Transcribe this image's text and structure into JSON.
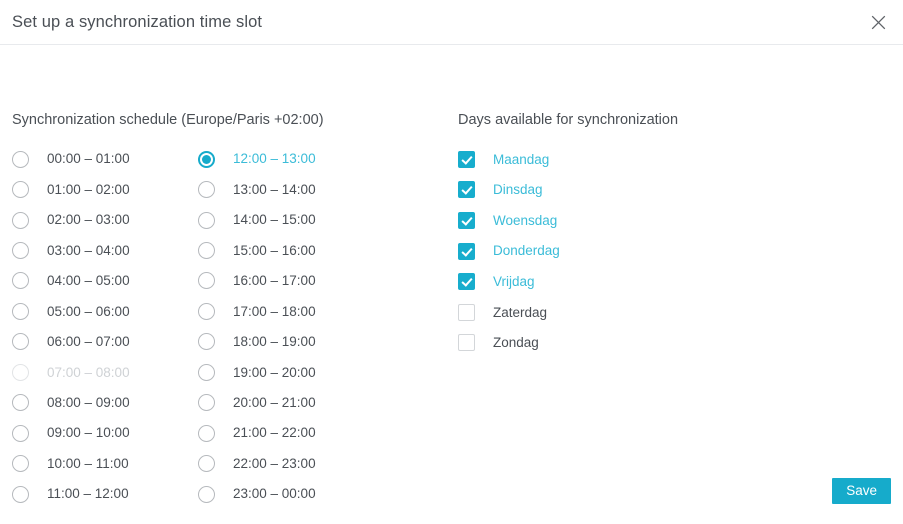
{
  "header": {
    "title": "Set up a synchronization time slot",
    "close_icon": "close-icon"
  },
  "schedule": {
    "heading": "Synchronization schedule (Europe/Paris +02:00)",
    "column1": [
      {
        "label": "00:00 – 01:00",
        "selected": false,
        "disabled": false
      },
      {
        "label": "01:00 – 02:00",
        "selected": false,
        "disabled": false
      },
      {
        "label": "02:00 – 03:00",
        "selected": false,
        "disabled": false
      },
      {
        "label": "03:00 – 04:00",
        "selected": false,
        "disabled": false
      },
      {
        "label": "04:00 – 05:00",
        "selected": false,
        "disabled": false
      },
      {
        "label": "05:00 – 06:00",
        "selected": false,
        "disabled": false
      },
      {
        "label": "06:00 – 07:00",
        "selected": false,
        "disabled": false
      },
      {
        "label": "07:00 – 08:00",
        "selected": false,
        "disabled": true
      },
      {
        "label": "08:00 – 09:00",
        "selected": false,
        "disabled": false
      },
      {
        "label": "09:00 – 10:00",
        "selected": false,
        "disabled": false
      },
      {
        "label": "10:00 – 11:00",
        "selected": false,
        "disabled": false
      },
      {
        "label": "11:00 – 12:00",
        "selected": false,
        "disabled": false
      }
    ],
    "column2": [
      {
        "label": "12:00 – 13:00",
        "selected": true,
        "disabled": false
      },
      {
        "label": "13:00 – 14:00",
        "selected": false,
        "disabled": false
      },
      {
        "label": "14:00 – 15:00",
        "selected": false,
        "disabled": false
      },
      {
        "label": "15:00 – 16:00",
        "selected": false,
        "disabled": false
      },
      {
        "label": "16:00 – 17:00",
        "selected": false,
        "disabled": false
      },
      {
        "label": "17:00 – 18:00",
        "selected": false,
        "disabled": false
      },
      {
        "label": "18:00 – 19:00",
        "selected": false,
        "disabled": false
      },
      {
        "label": "19:00 – 20:00",
        "selected": false,
        "disabled": false
      },
      {
        "label": "20:00 – 21:00",
        "selected": false,
        "disabled": false
      },
      {
        "label": "21:00 – 22:00",
        "selected": false,
        "disabled": false
      },
      {
        "label": "22:00 – 23:00",
        "selected": false,
        "disabled": false
      },
      {
        "label": "23:00 – 00:00",
        "selected": false,
        "disabled": false
      }
    ]
  },
  "days": {
    "heading": "Days available for synchronization",
    "items": [
      {
        "label": "Maandag",
        "checked": true
      },
      {
        "label": "Dinsdag",
        "checked": true
      },
      {
        "label": "Woensdag",
        "checked": true
      },
      {
        "label": "Donderdag",
        "checked": true
      },
      {
        "label": "Vrijdag",
        "checked": true
      },
      {
        "label": "Zaterdag",
        "checked": false
      },
      {
        "label": "Zondag",
        "checked": false
      }
    ]
  },
  "footer": {
    "save_label": "Save"
  },
  "colors": {
    "accent": "#16abcb",
    "accent_text": "#3bbcd8",
    "text": "#4a4f55",
    "disabled_text": "#cfd2d5",
    "border": "#e8eaed"
  }
}
